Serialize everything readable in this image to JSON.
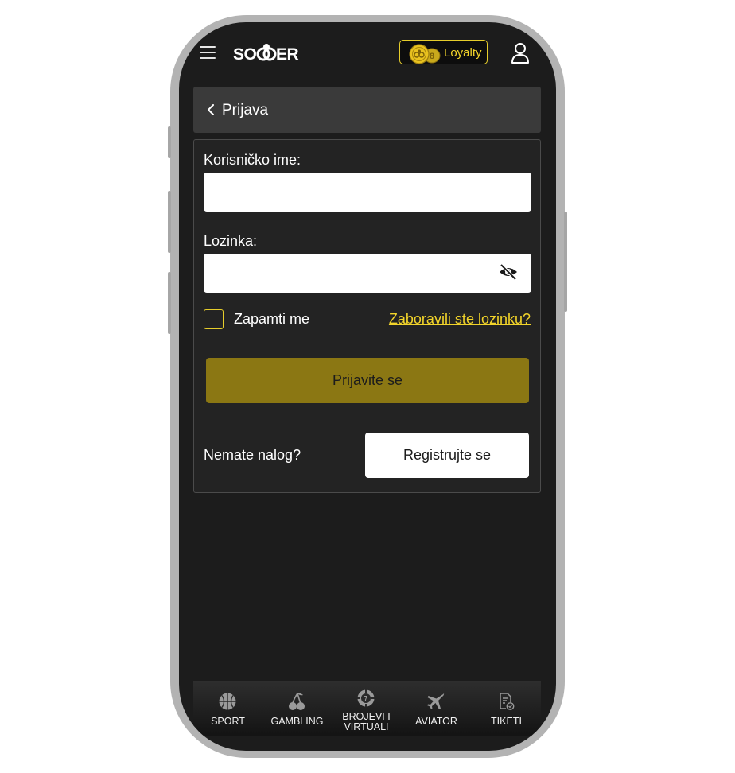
{
  "header": {
    "logo_text": "SOCCER",
    "loyalty_label": "Loyalty"
  },
  "title_bar": {
    "title": "Prijava"
  },
  "form": {
    "username_label": "Korisničko ime:",
    "username_value": "",
    "password_label": "Lozinka:",
    "password_value": "",
    "remember_label": "Zapamti me",
    "remember_checked": false,
    "forgot_link": "Zaboravili ste lozinku?",
    "login_button": "Prijavite se",
    "no_account_text": "Nemate nalog?",
    "register_button": "Registrujte se"
  },
  "bottom_nav": {
    "items": [
      {
        "label": "SPORT",
        "icon": "basketball-icon"
      },
      {
        "label": "GAMBLING",
        "icon": "cherries-icon"
      },
      {
        "label_line1": "BROJEVI I",
        "label_line2": "VIRTUALI",
        "icon": "roulette-chip-icon"
      },
      {
        "label": "AVIATOR",
        "icon": "airplane-icon"
      },
      {
        "label": "TIKETI",
        "icon": "ticket-document-icon"
      }
    ]
  },
  "colors": {
    "accent_yellow": "#f2d42a",
    "login_button": "#8b7713",
    "background": "#1c1c1c",
    "panel": "#232323",
    "title_bar": "#3a3a3a"
  }
}
